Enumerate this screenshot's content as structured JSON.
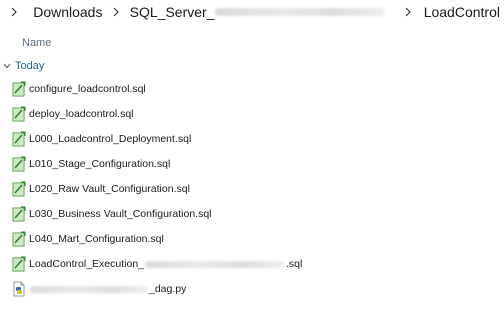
{
  "breadcrumb": {
    "items": [
      {
        "label": "Downloads"
      },
      {
        "label_prefix": "SQL_Server_"
      },
      {
        "label": "LoadControl"
      }
    ]
  },
  "columns": {
    "name": "Name"
  },
  "group": {
    "label": "Today"
  },
  "files": [
    {
      "name": "configure_loadcontrol.sql",
      "icon": "sql-file-icon"
    },
    {
      "name": "deploy_loadcontrol.sql",
      "icon": "sql-file-icon"
    },
    {
      "name": "L000_Loadcontrol_Deployment.sql",
      "icon": "sql-file-icon"
    },
    {
      "name": "L010_Stage_Configuration.sql",
      "icon": "sql-file-icon"
    },
    {
      "name": "L020_Raw Vault_Configuration.sql",
      "icon": "sql-file-icon"
    },
    {
      "name": "L030_Business Vault_Configuration.sql",
      "icon": "sql-file-icon"
    },
    {
      "name": "L040_Mart_Configuration.sql",
      "icon": "sql-file-icon"
    },
    {
      "name_prefix": "LoadControl_Execution_",
      "name_suffix": ".sql",
      "icon": "sql-file-icon"
    },
    {
      "name_suffix": "_dag.py",
      "icon": "python-file-icon"
    }
  ],
  "colors": {
    "accent": "#27609a",
    "sql_icon_green": "#4a9a3a",
    "python_icon_blue": "#3a6fb0"
  }
}
